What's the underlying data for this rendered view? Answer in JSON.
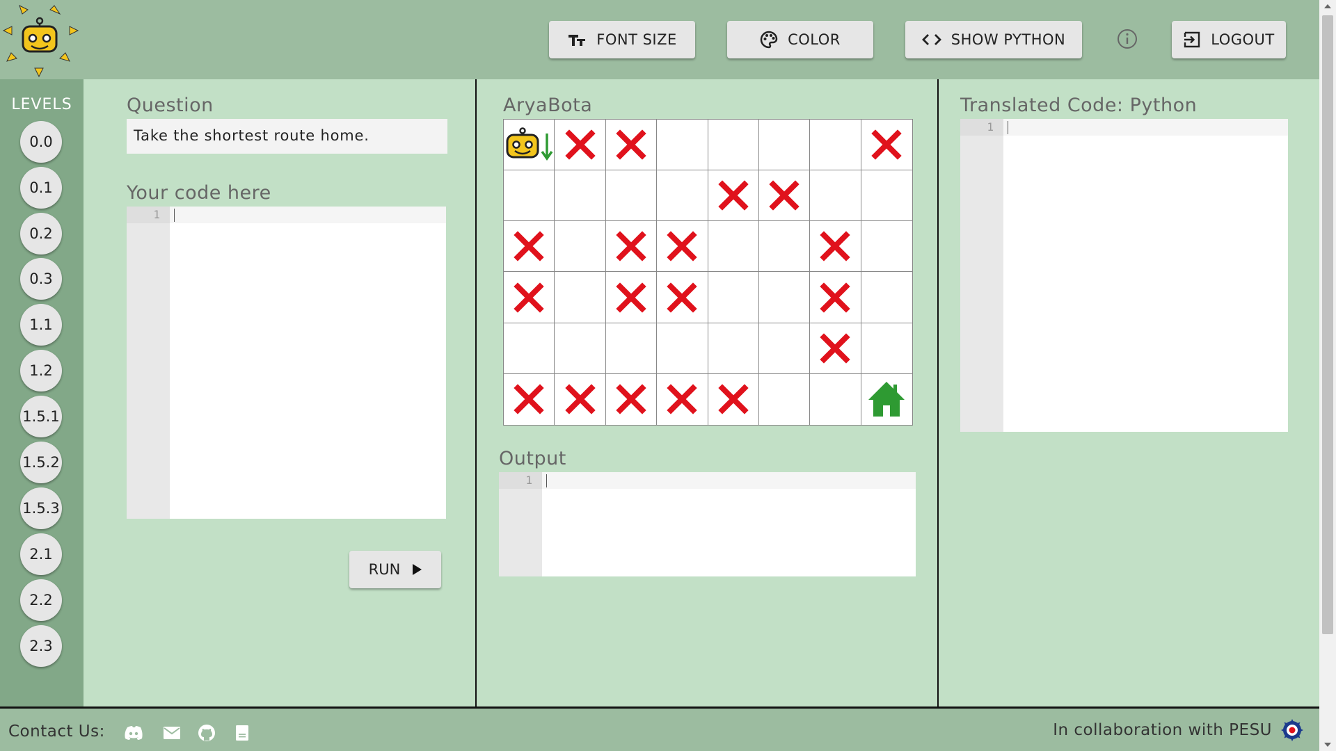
{
  "header": {
    "buttons": {
      "font_size": "FONT SIZE",
      "color": "COLOR",
      "show_python": "SHOW PYTHON",
      "logout": "LOGOUT"
    }
  },
  "levels": {
    "title": "LEVELS",
    "items": [
      "0.0",
      "0.1",
      "0.2",
      "0.3",
      "1.1",
      "1.2",
      "1.5.1",
      "1.5.2",
      "1.5.3",
      "2.1",
      "2.2",
      "2.3"
    ]
  },
  "question": {
    "label": "Question",
    "text": "Take the shortest route home."
  },
  "code": {
    "label": "Your code here",
    "line_number": "1"
  },
  "run": {
    "label": "RUN"
  },
  "board": {
    "label": "AryaBota",
    "rows": 6,
    "cols": 8,
    "cells": [
      [
        "robot-down",
        "x",
        "x",
        "",
        "",
        "",
        "",
        "x"
      ],
      [
        "",
        "",
        "",
        "",
        "x",
        "x",
        "",
        ""
      ],
      [
        "x",
        "",
        "x",
        "x",
        "",
        "",
        "x",
        ""
      ],
      [
        "x",
        "",
        "x",
        "x",
        "",
        "",
        "x",
        ""
      ],
      [
        "",
        "",
        "",
        "",
        "",
        "",
        "x",
        ""
      ],
      [
        "x",
        "x",
        "x",
        "x",
        "x",
        "",
        "",
        "home"
      ]
    ],
    "colors": {
      "obstacle": "#e0121c",
      "home": "#2e9a32",
      "arrow": "#2e9a32"
    }
  },
  "output": {
    "label": "Output",
    "line_number": "1"
  },
  "translated": {
    "label": "Translated Code: Python",
    "line_number": "1"
  },
  "footer": {
    "contact_label": "Contact Us:",
    "collab_text": "In collaboration with PESU",
    "icons": [
      "discord-icon",
      "mail-icon",
      "github-icon",
      "docs-icon"
    ]
  }
}
